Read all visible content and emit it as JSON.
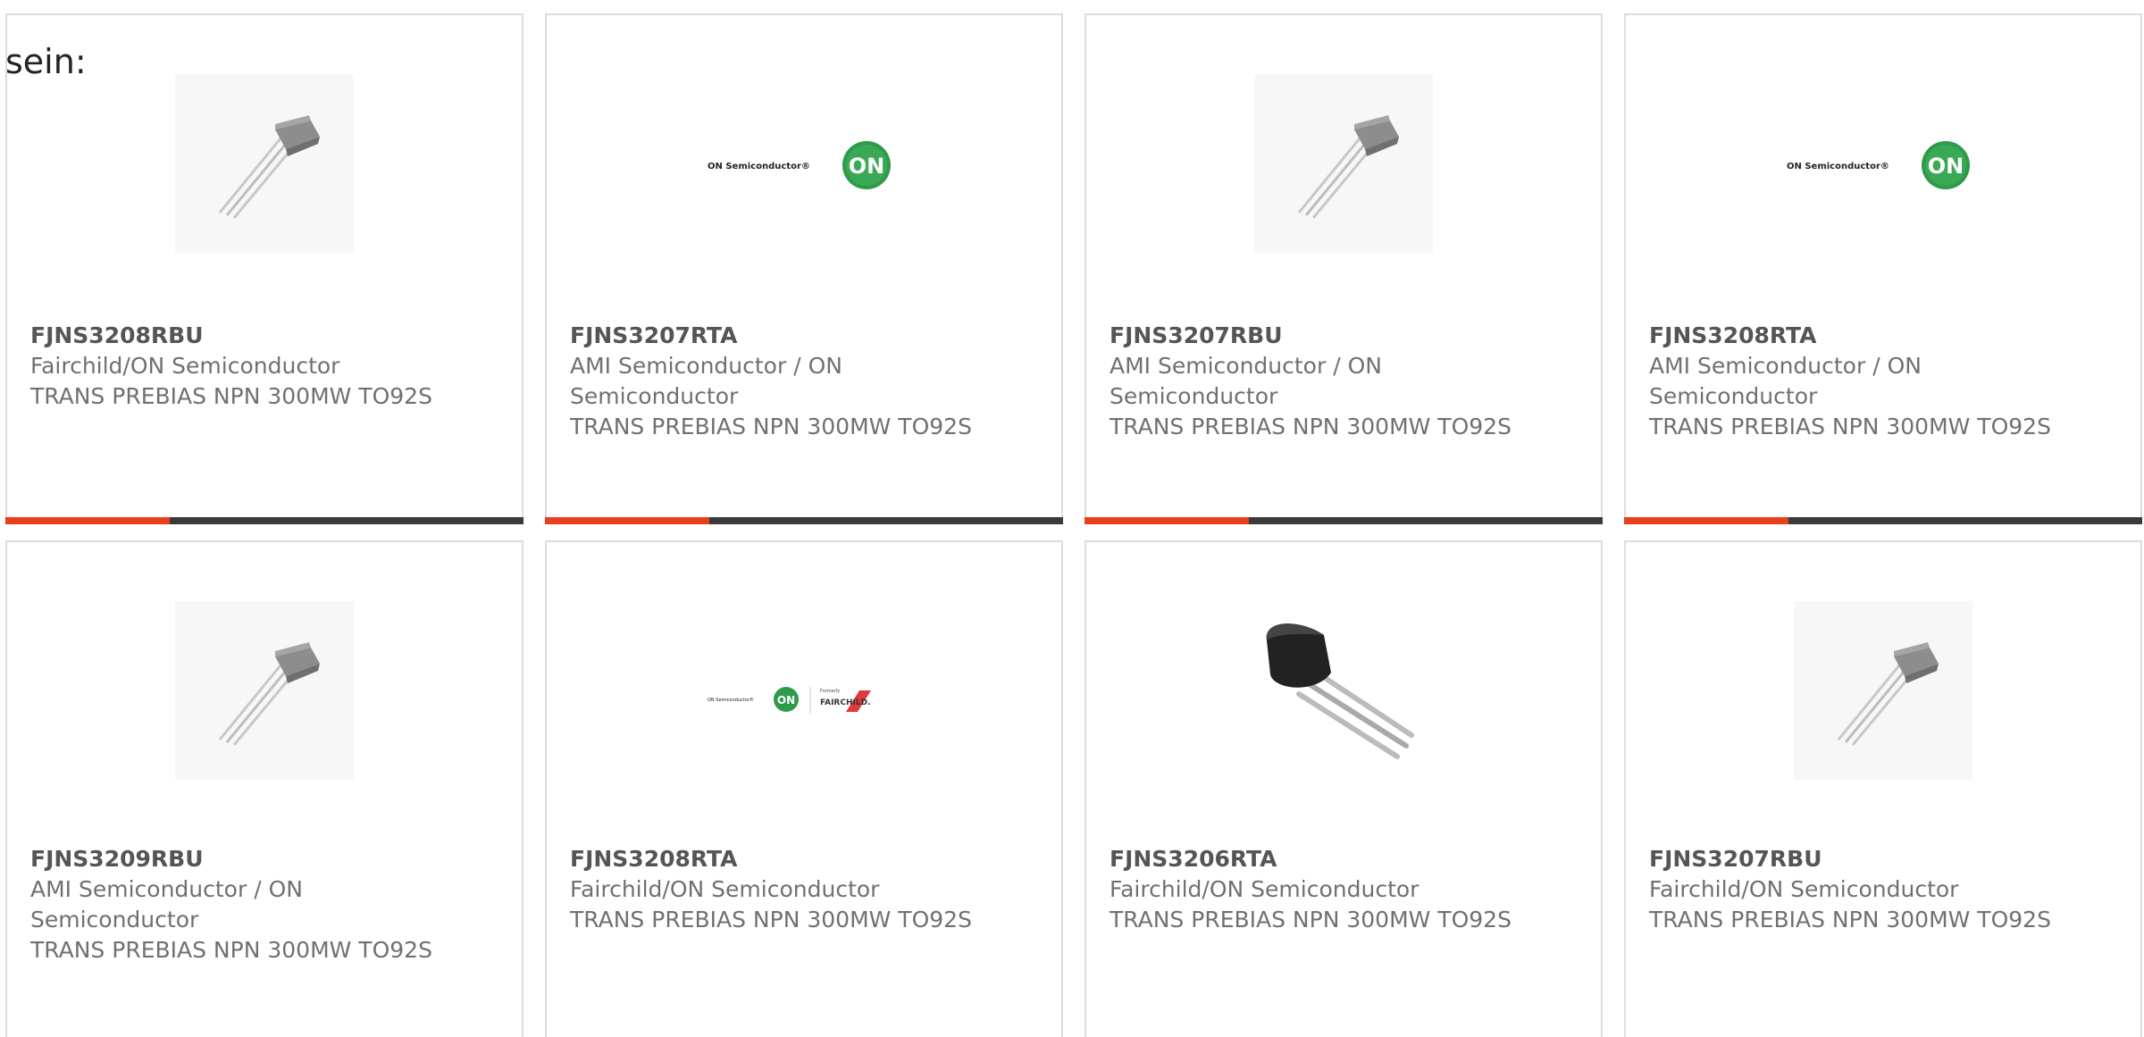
{
  "intro_text": "sein:",
  "colors": {
    "accent": "#e8401c",
    "bar": "#3a3a3a",
    "border": "#dddddd",
    "text": "#707070"
  },
  "products": [
    {
      "part_number": "FJNS3208RBU",
      "manufacturer": "Fairchild/ON Semiconductor",
      "description": "TRANS PREBIAS NPN 300MW TO92S",
      "image": "to92-transistor-icon",
      "show_bar": true
    },
    {
      "part_number": "FJNS3207RTA",
      "manufacturer": "AMI Semiconductor / ON Semiconductor",
      "description": "TRANS PREBIAS NPN 300MW TO92S",
      "image": "on-semiconductor-logo",
      "logo_text": "ON Semiconductor®",
      "logo_badge": "ON",
      "show_bar": true
    },
    {
      "part_number": "FJNS3207RBU",
      "manufacturer": "AMI Semiconductor / ON Semiconductor",
      "description": "TRANS PREBIAS NPN 300MW TO92S",
      "image": "to92-transistor-icon",
      "show_bar": true
    },
    {
      "part_number": "FJNS3208RTA",
      "manufacturer": "AMI Semiconductor / ON Semiconductor",
      "description": "TRANS PREBIAS NPN 300MW TO92S",
      "image": "on-semiconductor-logo",
      "logo_text": "ON Semiconductor®",
      "logo_badge": "ON",
      "show_bar": true
    },
    {
      "part_number": "FJNS3209RBU",
      "manufacturer": "AMI Semiconductor / ON Semiconductor",
      "description": "TRANS PREBIAS NPN 300MW TO92S",
      "image": "to92-transistor-icon",
      "show_bar": false
    },
    {
      "part_number": "FJNS3208RTA",
      "manufacturer": "Fairchild/ON Semiconductor",
      "description": "TRANS PREBIAS NPN 300MW TO92S",
      "image": "on-fairchild-logo",
      "logo_text": "ON Semiconductor®",
      "logo_badge": "ON",
      "logo_small": "Formerly",
      "logo_brand": "FAIRCHILD.",
      "show_bar": false
    },
    {
      "part_number": "FJNS3206RTA",
      "manufacturer": "Fairchild/ON Semiconductor",
      "description": "TRANS PREBIAS NPN 300MW TO92S",
      "image": "to92-black-transistor-icon",
      "show_bar": false
    },
    {
      "part_number": "FJNS3207RBU",
      "manufacturer": "Fairchild/ON Semiconductor",
      "description": "TRANS PREBIAS NPN 300MW TO92S",
      "image": "to92-transistor-icon",
      "show_bar": false
    }
  ]
}
